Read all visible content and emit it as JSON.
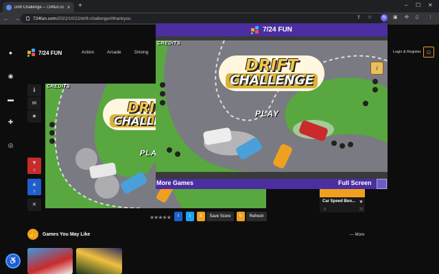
{
  "browser": {
    "tab_title": "Drift Challenge – 724fun.com",
    "url_domain": "724fun.com",
    "url_path": "/2022/10/22/drift-challenge/#thankyou",
    "extension_badge": "N"
  },
  "site": {
    "brand": "7/24 FUN",
    "menu": [
      "Action",
      "Arcade",
      "Driving"
    ],
    "login_label": "Login & Register"
  },
  "game": {
    "credits_label": "CREDITS",
    "title_line1": "DRIFT",
    "title_line2": "CHALLENGE",
    "play_label": "PLAY"
  },
  "left_tools": {
    "like_count": "0",
    "dislike_count": "0"
  },
  "share": {
    "save_score": "Save Score",
    "refresh": "Refresh"
  },
  "recommended": {
    "title": "Car Speed Boo...",
    "stat_left": "0",
    "stat_right": "22"
  },
  "section": {
    "heading": "Games You May Like",
    "more": "More"
  },
  "popup": {
    "header": "7/24 FUN",
    "credits_label": "CREDITS",
    "title_line1": "DRIFT",
    "title_line2": "CHALLENGE",
    "play_label": "PLAY",
    "more_games": "More Games",
    "full_screen": "Full Screen"
  },
  "colors": {
    "accent": "#f0a020",
    "popup_bar": "#4b2ea0",
    "like": "#1d5fcf",
    "dislike": "#c92a2a"
  }
}
